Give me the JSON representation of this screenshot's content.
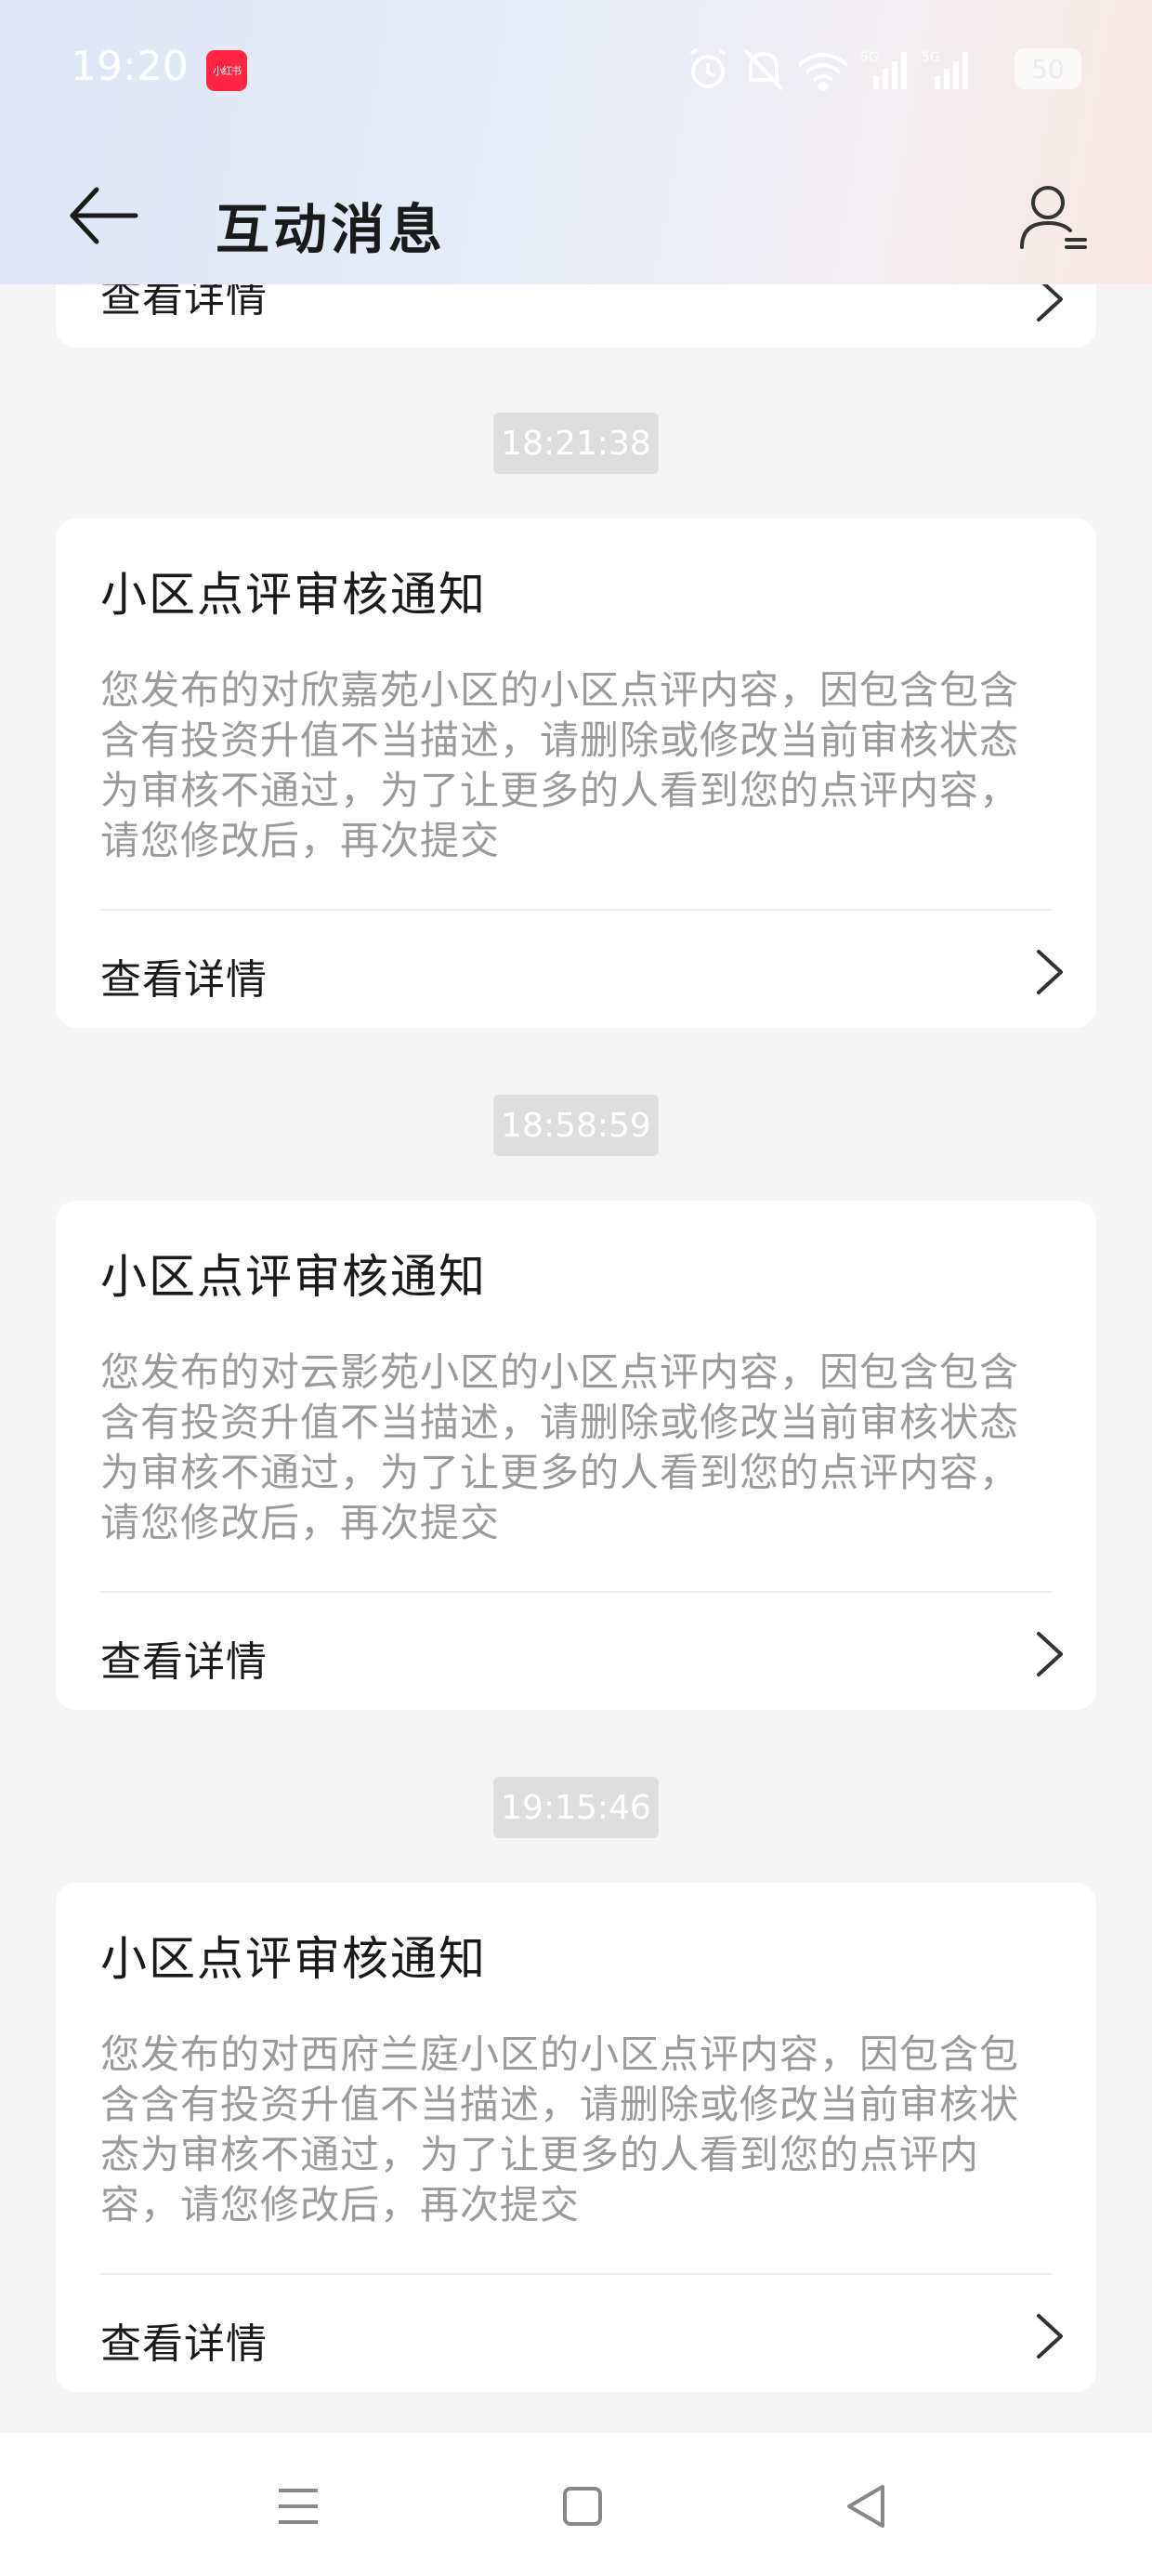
{
  "status_bar": {
    "time": "19:20",
    "app_icon_text": "小红书",
    "network_label": "5G",
    "battery": "50",
    "icons": [
      "alarm-icon",
      "mute-icon",
      "wifi-icon",
      "signal-5g-icon",
      "signal-5g-icon",
      "battery-icon"
    ]
  },
  "header": {
    "title": "互动消息",
    "back_icon": "back-arrow-icon",
    "user_icon": "user-settings-icon"
  },
  "messages": [
    {
      "title": "",
      "body": "",
      "detail_label": "查看详情",
      "timestamp": ""
    },
    {
      "timestamp": "18:21:38",
      "title": "小区点评审核通知",
      "body": "您发布的对欣嘉苑小区的小区点评内容，因包含包含含有投资升值不当描述，请删除或修改当前审核状态为审核不通过，为了让更多的人看到您的点评内容，请您修改后，再次提交",
      "detail_label": "查看详情"
    },
    {
      "timestamp": "18:58:59",
      "title": "小区点评审核通知",
      "body": "您发布的对云影苑小区的小区点评内容，因包含包含含有投资升值不当描述，请删除或修改当前审核状态为审核不通过，为了让更多的人看到您的点评内容，请您修改后，再次提交",
      "detail_label": "查看详情"
    },
    {
      "timestamp": "19:15:46",
      "title": "小区点评审核通知",
      "body": "您发布的对西府兰庭小区的小区点评内容，因包含包含含有投资升值不当描述，请删除或修改当前审核状态为审核不通过，为了让更多的人看到您的点评内容，请您修改后，再次提交",
      "detail_label": "查看详情"
    }
  ],
  "navbar": {
    "icons": [
      "menu-icon",
      "home-icon",
      "back-triangle-icon"
    ]
  },
  "colors": {
    "accent": "#ff2442",
    "background": "#f5f5f5",
    "card": "#ffffff",
    "body_text": "#9a9a9a",
    "timestamp_bg": "#dedede"
  }
}
